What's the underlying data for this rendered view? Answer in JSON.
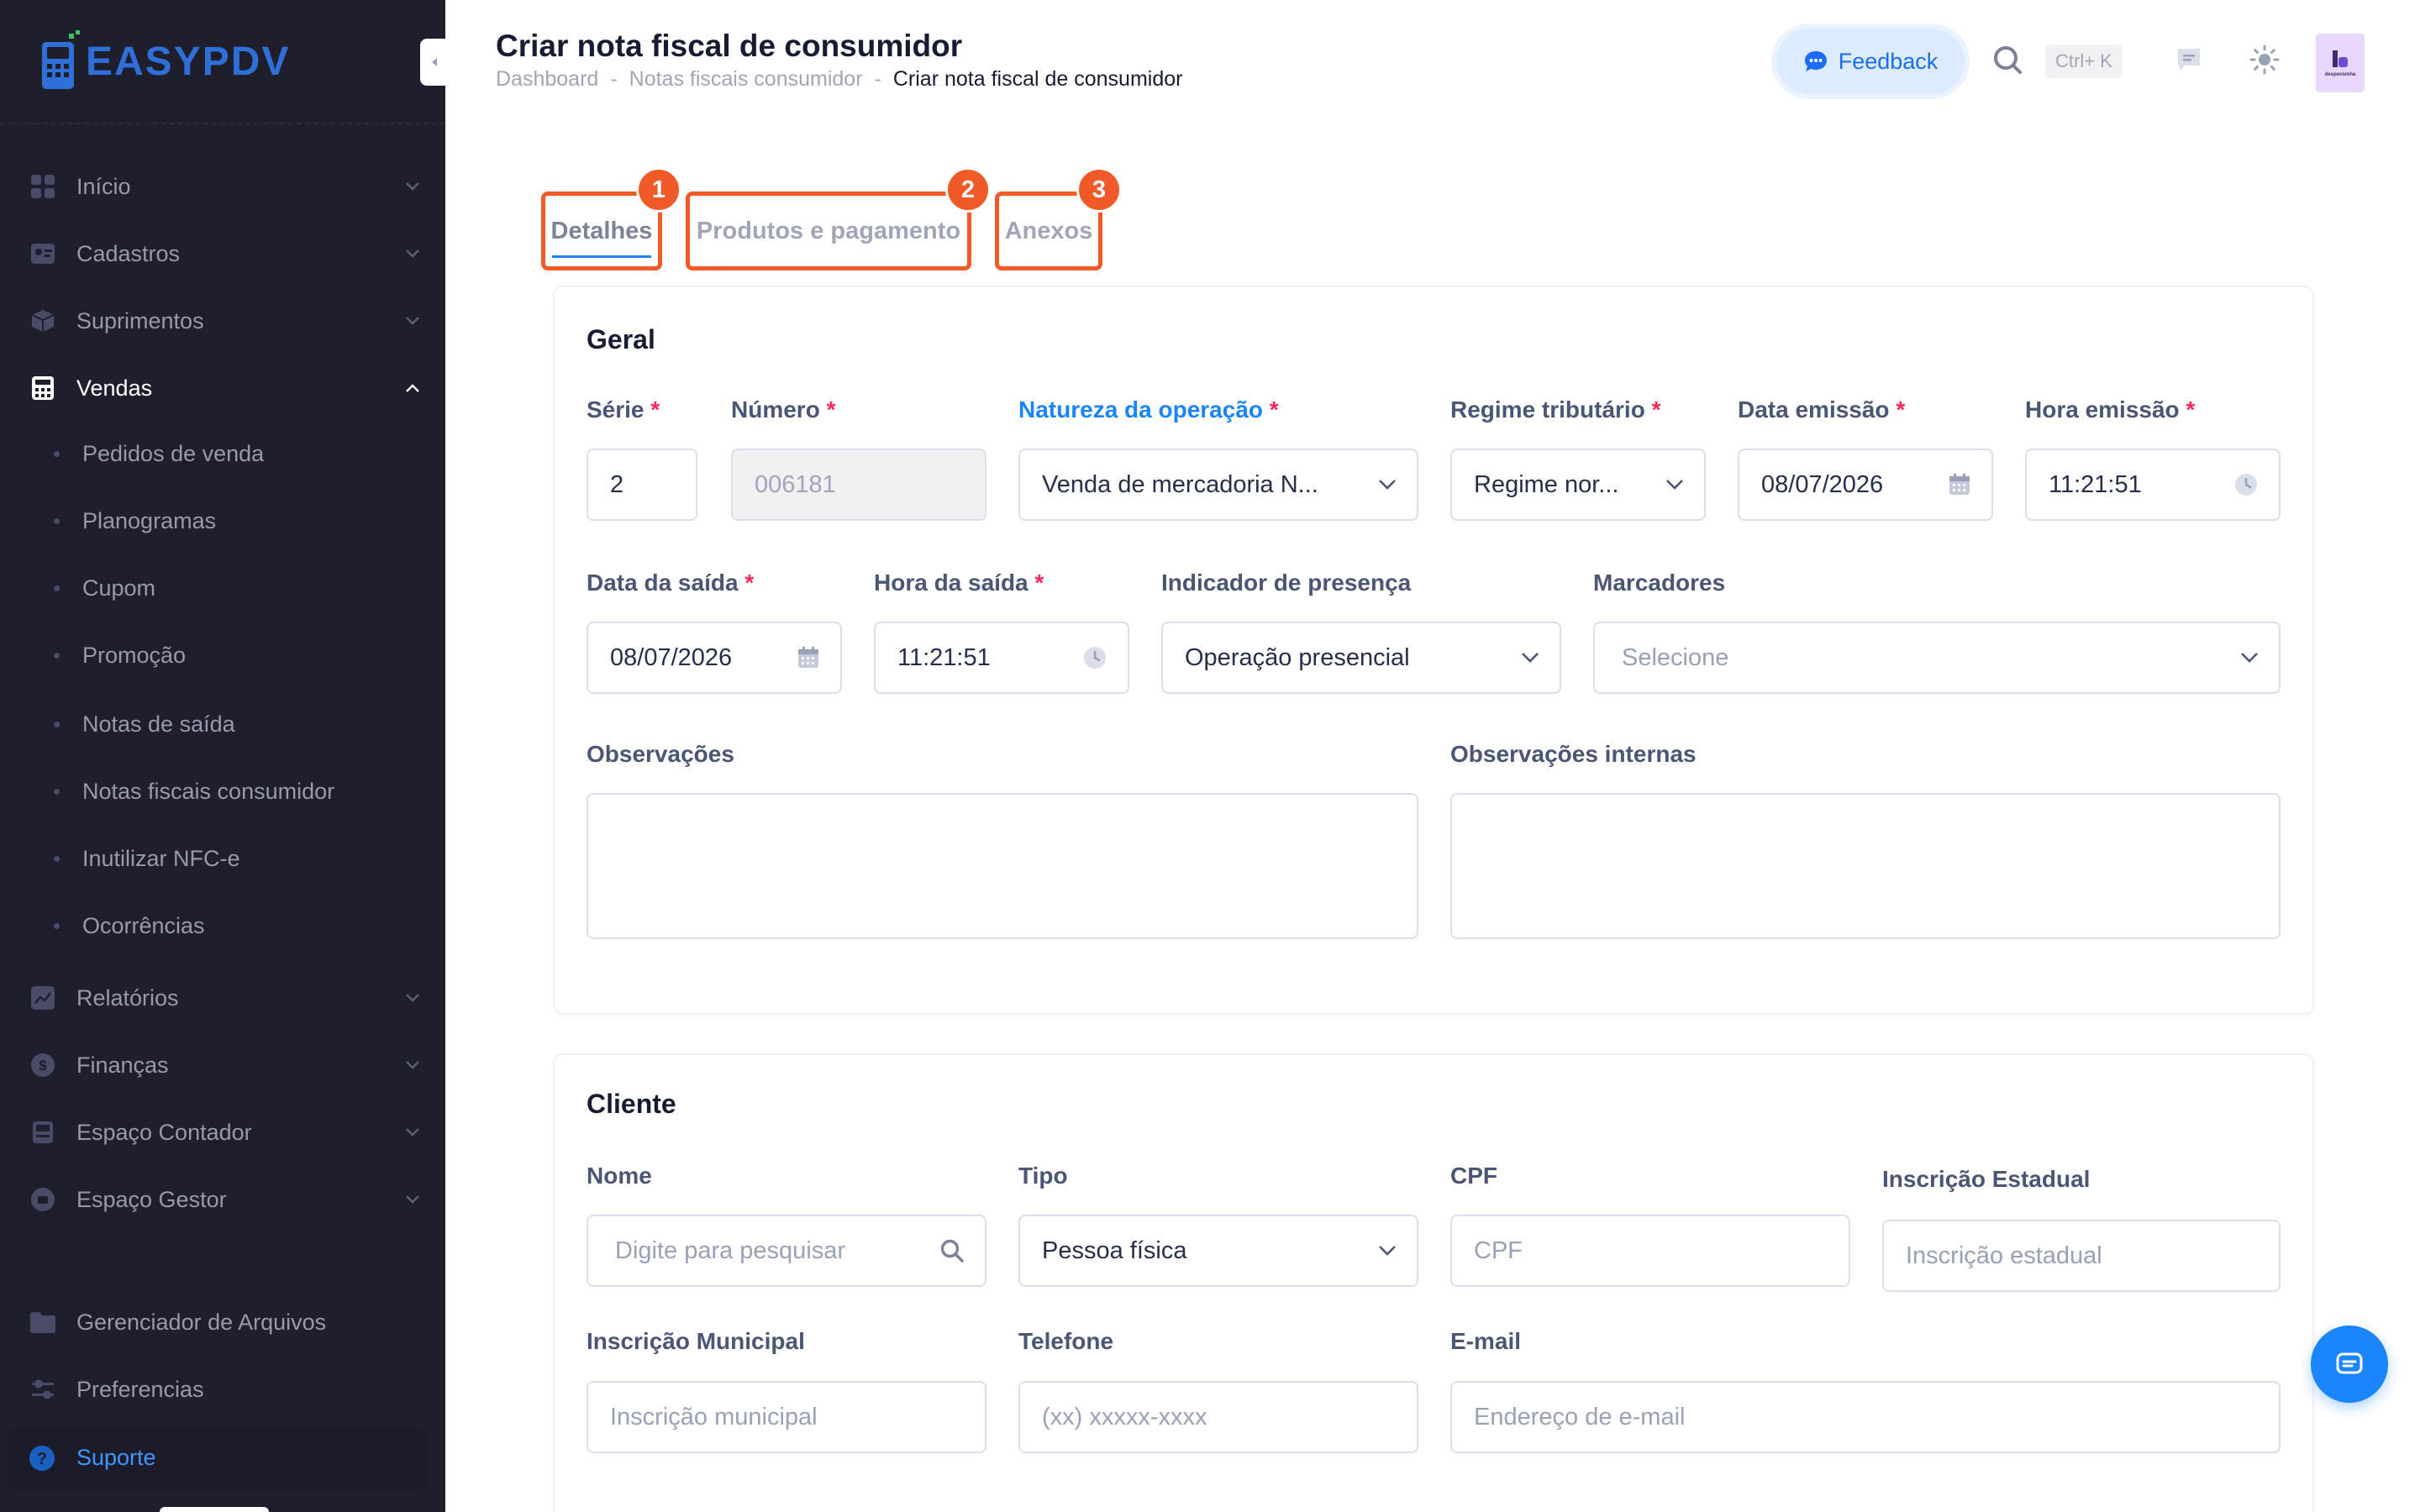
{
  "app": {
    "logo_prefix": "EASY",
    "logo_suffix": "PDV"
  },
  "sidebar": {
    "items": [
      {
        "label": "Início",
        "icon": "grid-icon"
      },
      {
        "label": "Cadastros",
        "icon": "id-card-icon"
      },
      {
        "label": "Suprimentos",
        "icon": "box-icon"
      },
      {
        "label": "Vendas",
        "icon": "calculator-icon"
      },
      {
        "label": "Relatórios",
        "icon": "chart-icon"
      },
      {
        "label": "Finanças",
        "icon": "dollar-icon"
      },
      {
        "label": "Espaço Contador",
        "icon": "printer-icon"
      },
      {
        "label": "Espaço Gestor",
        "icon": "briefcase-icon"
      },
      {
        "label": "Gerenciador de Arquivos",
        "icon": "folder-icon"
      },
      {
        "label": "Preferencias",
        "icon": "sliders-icon"
      },
      {
        "label": "Suporte",
        "icon": "question-icon"
      }
    ],
    "vendas_sub": [
      "Pedidos de venda",
      "Planogramas",
      "Cupom",
      "Promoção",
      "Notas de saída",
      "Notas fiscais consumidor",
      "Inutilizar NFC-e",
      "Ocorrências"
    ]
  },
  "header": {
    "title": "Criar nota fiscal de consumidor",
    "breadcrumb": [
      "Dashboard",
      "Notas fiscais consumidor",
      "Criar nota fiscal de consumidor"
    ],
    "breadcrumb_sep": "-",
    "feedback_label": "Feedback",
    "shortcut": "Ctrl+ K",
    "avatar_text": "despensinha"
  },
  "tabs": [
    {
      "label": "Detalhes",
      "badge": "1"
    },
    {
      "label": "Produtos e pagamento",
      "badge": "2"
    },
    {
      "label": "Anexos",
      "badge": "3"
    }
  ],
  "geral": {
    "title": "Geral",
    "serie": {
      "label": "Série",
      "value": "2"
    },
    "numero": {
      "label": "Número",
      "value": "006181"
    },
    "natureza": {
      "label": "Natureza da operação",
      "value": "Venda de mercadoria N..."
    },
    "regime": {
      "label": "Regime tributário",
      "value": "Regime nor..."
    },
    "data_emissao": {
      "label": "Data emissão",
      "value": "08/07/2026"
    },
    "hora_emissao": {
      "label": "Hora emissão",
      "value": "11:21:51"
    },
    "data_saida": {
      "label": "Data da saída",
      "value": "08/07/2026"
    },
    "hora_saida": {
      "label": "Hora da saída",
      "value": "11:21:51"
    },
    "presenca": {
      "label": "Indicador de presença",
      "value": "Operação presencial"
    },
    "marcadores": {
      "label": "Marcadores",
      "placeholder": "Selecione"
    },
    "observacoes": {
      "label": "Observações"
    },
    "observacoes_internas": {
      "label": "Observações internas"
    },
    "required_mark": "*"
  },
  "cliente": {
    "title": "Cliente",
    "nome": {
      "label": "Nome",
      "placeholder": "Digite para pesquisar"
    },
    "tipo": {
      "label": "Tipo",
      "value": "Pessoa física"
    },
    "cpf": {
      "label": "CPF",
      "placeholder": "CPF"
    },
    "ie": {
      "label": "Inscrição Estadual",
      "placeholder": "Inscrição estadual"
    },
    "im": {
      "label": "Inscrição Municipal",
      "placeholder": "Inscrição municipal"
    },
    "telefone": {
      "label": "Telefone",
      "placeholder": "(xx) xxxxx-xxxx"
    },
    "email": {
      "label": "E-mail",
      "placeholder": "Endereço de e-mail"
    }
  },
  "colors": {
    "sidebar_bg": "#1e1e2d",
    "accent": "#1b84ff",
    "tab_highlight": "#f05a28",
    "required": "#f8285a"
  }
}
